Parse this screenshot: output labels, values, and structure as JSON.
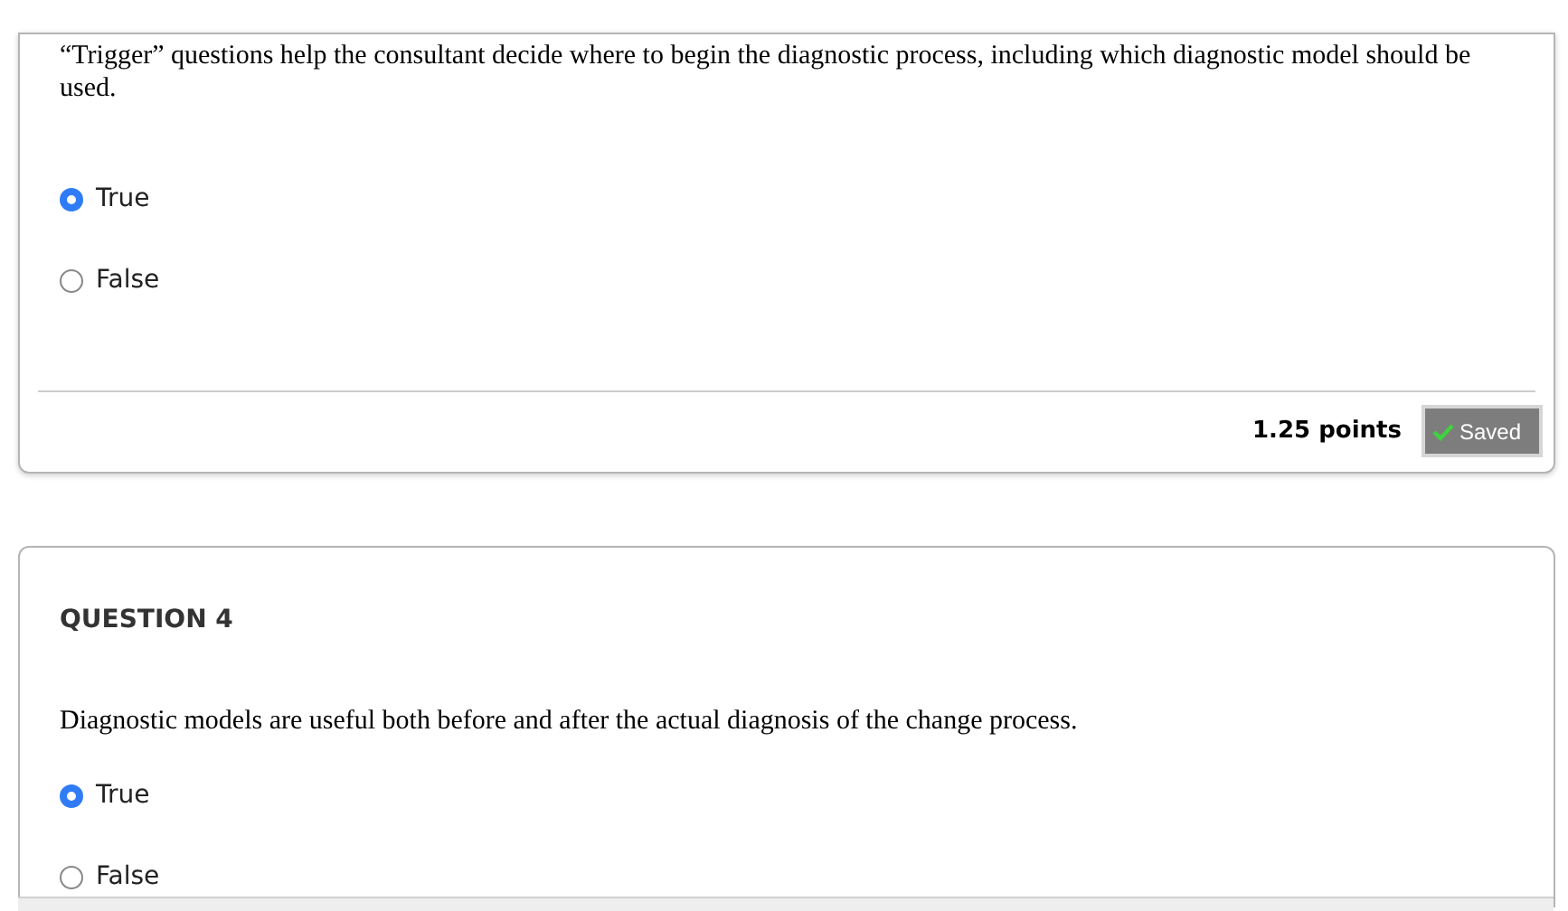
{
  "questions": [
    {
      "text": "“Trigger” questions help the consultant decide where to begin the diagnostic process, including which diagnostic model should be used.",
      "options": [
        {
          "label": "True",
          "selected": true
        },
        {
          "label": "False",
          "selected": false
        }
      ],
      "points": "1.25 points",
      "status": "Saved"
    },
    {
      "heading": "QUESTION 4",
      "text": "Diagnostic models are useful both before and after the actual diagnosis of the change process.",
      "options": [
        {
          "label": "True",
          "selected": true
        },
        {
          "label": "False",
          "selected": false
        }
      ]
    }
  ]
}
